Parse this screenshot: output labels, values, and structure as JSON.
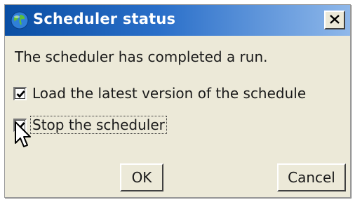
{
  "dialog": {
    "title": "Scheduler status",
    "title_icon": "globe-icon",
    "close_icon": "close-x-icon",
    "message": "The scheduler has completed a run.",
    "options": [
      {
        "label": "Load the latest version of the schedule",
        "checked": true
      },
      {
        "label": "Stop the scheduler",
        "checked": true,
        "focused": true
      }
    ],
    "buttons": {
      "ok": "OK",
      "cancel": "Cancel"
    }
  },
  "colors": {
    "titlebar_start": "#0a4ea3",
    "titlebar_end": "#8fb8ea",
    "dialog_bg": "#ece9d8"
  }
}
